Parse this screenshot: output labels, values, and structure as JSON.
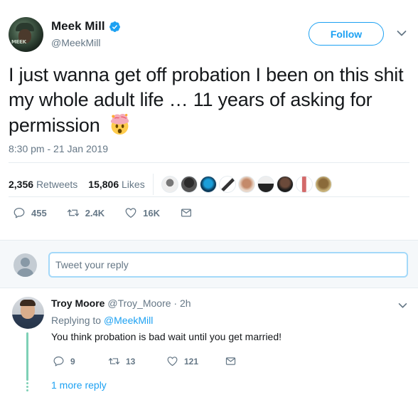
{
  "tweet": {
    "display_name": "Meek Mill",
    "handle": "@MeekMill",
    "avatar_label": "MEEK",
    "follow_label": "Follow",
    "text": "I just wanna get off probation I been on this shit my whole adult life … 11 years of asking for permission",
    "emoji": "exploding-head-emoji",
    "timestamp": "8:30 pm - 21 Jan 2019",
    "retweets_count": "2,356",
    "retweets_label": "Retweets",
    "likes_count": "15,806",
    "likes_label": "Likes",
    "replies": "455",
    "retweets_short": "2.4K",
    "likes_short": "16K"
  },
  "composer": {
    "placeholder": "Tweet your reply"
  },
  "reply": {
    "display_name": "Troy Moore",
    "handle": "@Troy_Moore",
    "separator": "·",
    "time": "2h",
    "replying_to_prefix": "Replying to",
    "replying_to_handle": "@MeekMill",
    "text": "You think probation is bad wait until you get married!",
    "replies": "9",
    "retweets": "13",
    "likes": "121",
    "more_replies": "1 more reply"
  },
  "colors": {
    "accent": "#1da1f2",
    "text": "#14171a",
    "muted": "#657786",
    "border": "#e6ecf0",
    "thread": "#7ed0b6",
    "composer_bg": "#f5f8fa"
  },
  "likers_icons": [
    "avatar",
    "avatar",
    "avatar",
    "avatar",
    "avatar",
    "avatar",
    "avatar",
    "avatar",
    "avatar",
    "avatar"
  ]
}
